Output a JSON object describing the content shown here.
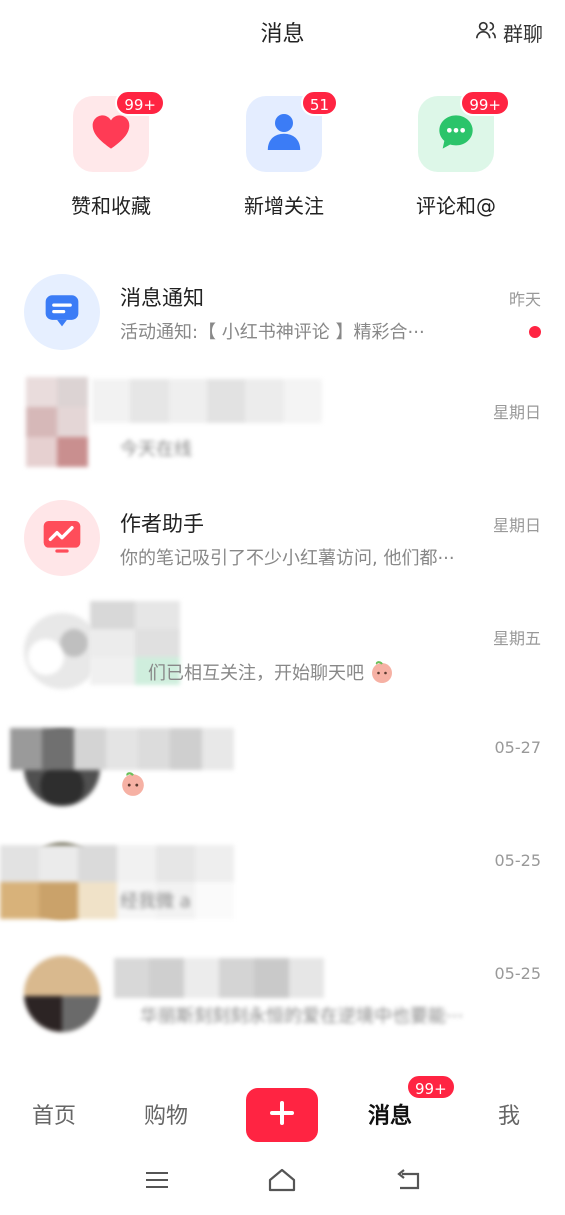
{
  "header": {
    "title": "消息",
    "group_chat_label": "群聊"
  },
  "tiles": [
    {
      "label": "赞和收藏",
      "badge": "99+",
      "icon": "heart-icon"
    },
    {
      "label": "新增关注",
      "badge": "51",
      "icon": "person-icon"
    },
    {
      "label": "评论和@",
      "badge": "99+",
      "icon": "chat-bubble-icon"
    }
  ],
  "messages": [
    {
      "name": "消息通知",
      "preview": "活动通知:【 小红书神评论 】精彩合···",
      "time": "昨天",
      "unread": true,
      "icon": "notification-icon"
    },
    {
      "name": "",
      "preview": "今天在线",
      "time": "星期日"
    },
    {
      "name": "作者助手",
      "preview": "你的笔记吸引了不少小红薯访问, 他们都···",
      "time": "星期日",
      "icon": "trend-chart-icon"
    },
    {
      "name": "",
      "preview": "们已相互关注，开始聊天吧",
      "time": "星期五"
    },
    {
      "name": "",
      "preview": "",
      "time": "05-27"
    },
    {
      "name": "",
      "preview": "经我微 a",
      "time": "05-25"
    },
    {
      "name": "",
      "preview": "华丽斯刻刻刻永恒的爱在逆境中也要能···",
      "time": "05-25"
    }
  ],
  "bottom_nav": {
    "home": "首页",
    "shop": "购物",
    "messages": "消息",
    "messages_badge": "99+",
    "me": "我"
  },
  "colors": {
    "accent": "#ff2442",
    "follow_blue": "#3b7cf6",
    "comment_green": "#2bc46a"
  }
}
